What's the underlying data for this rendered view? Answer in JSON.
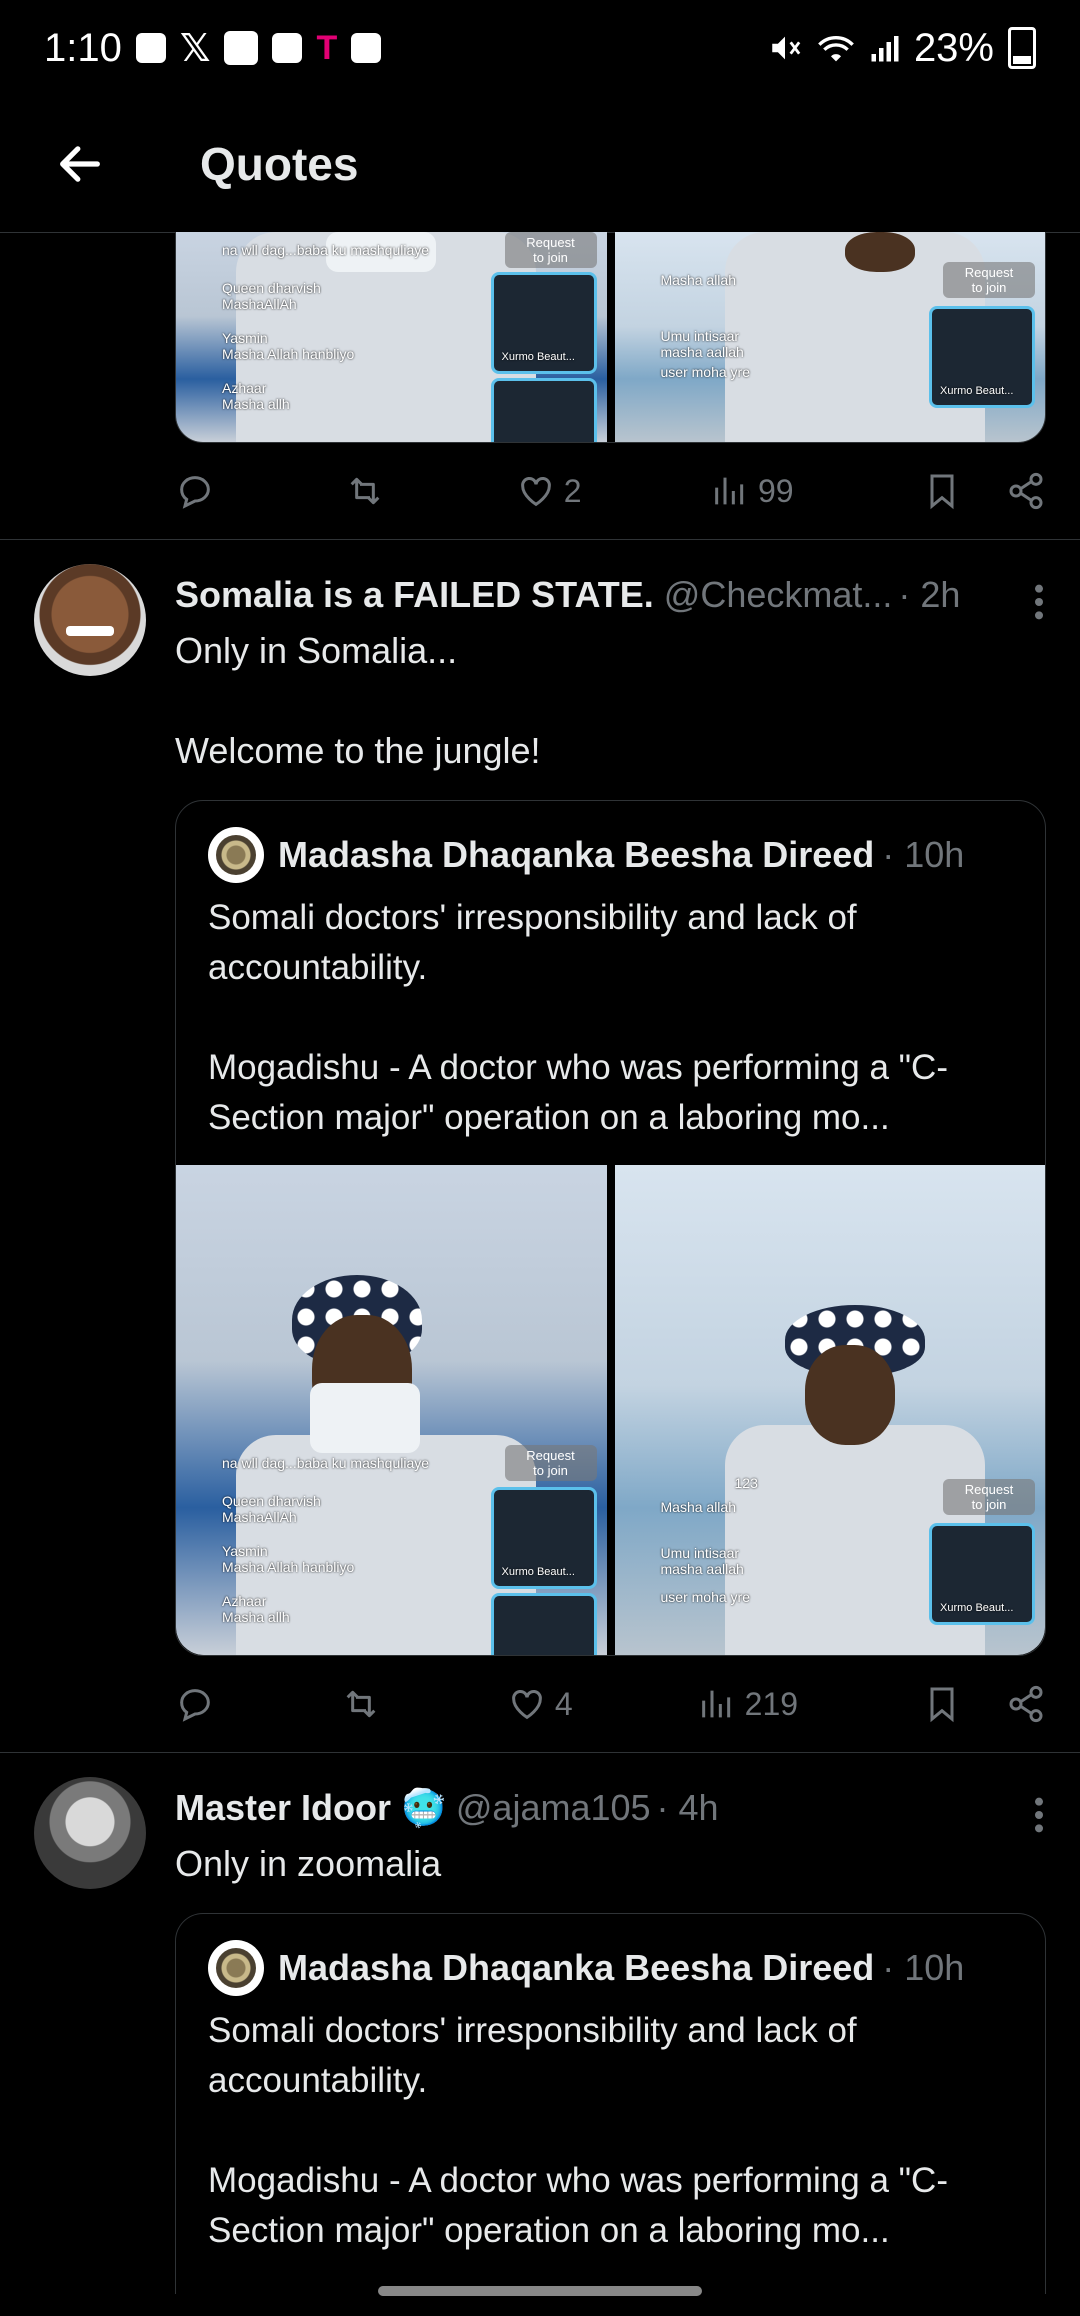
{
  "status_bar": {
    "time": "1:10",
    "battery": "23%"
  },
  "header": {
    "title": "Quotes"
  },
  "overlay": {
    "request": "Request\nto join",
    "xurmo": "Xurmo Beaut...",
    "queen": "Queen dharvish",
    "mashallah": "MashaAllAh",
    "yasmin": "Yasmin",
    "yasmin_msg": "Masha Allah hanbliyo",
    "azhaar": "Azhaar",
    "azhaar_msg": "Masha allh",
    "top_msg": "na wll dag...baba ku mashquliaye",
    "masha_allah": "Masha allah",
    "umu": "Umu intisaar",
    "umu_msg": "masha aallah",
    "user_moha": "user moha yre",
    "count": "123"
  },
  "prev_tweet": {
    "likes": "2",
    "views": "99"
  },
  "tweets": [
    {
      "display_name": "Somalia is a FAILED STATE.",
      "handle": "@Checkmat...",
      "time": "· 2h",
      "text": "Only in Somalia...\n\nWelcome to the jungle!",
      "quote": {
        "name": "Madasha Dhaqanka Beesha Direed",
        "time": "· 10h",
        "text": "Somali doctors' irresponsibility and lack of accountability.\n\nMogadishu - A doctor who was performing a \"C-Section major\" operation on a laboring mo..."
      },
      "likes": "4",
      "views": "219"
    },
    {
      "display_name": "Master Idoor",
      "emoji": "🥶",
      "handle": "@ajama105",
      "time": "· 4h",
      "text": "Only in zoomalia",
      "quote": {
        "name": "Madasha Dhaqanka Beesha Direed",
        "time": "· 10h",
        "text": "Somali doctors' irresponsibility and lack of accountability.\n\nMogadishu - A doctor who was performing a \"C-Section major\" operation on a laboring mo..."
      }
    }
  ],
  "colors": {
    "background": "#000000",
    "text": "#e7e9ea",
    "muted": "#71767b",
    "divider": "#2f3336"
  }
}
